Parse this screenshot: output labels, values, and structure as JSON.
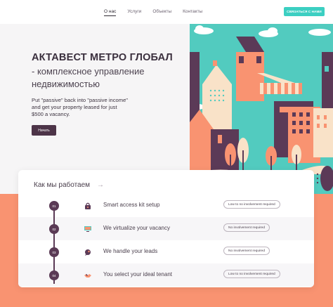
{
  "nav": {
    "links": [
      "О нас",
      "Услуги",
      "Объекты",
      "Контакты"
    ],
    "cta_label": "СВЯЗАТЬСЯ С НАМИ"
  },
  "hero": {
    "title": "АКТАВЕСТ МЕТРО ГЛОБАЛ",
    "subtitle": "- комплексное управление недвижимостью",
    "description": "Put \"passive\" back into \"passive income\" and get your property leased for just $500 a vacancy.",
    "button_label": "Начать"
  },
  "how": {
    "title": "Как мы работаем",
    "steps": [
      {
        "number": "01",
        "icon": "lock-icon",
        "label": "Smart access kit setup",
        "badge": "Low to no involvement required"
      },
      {
        "number": "02",
        "icon": "monitor-icon",
        "label": "We virtualize your vacancy",
        "badge": "No involvement required"
      },
      {
        "number": "03",
        "icon": "chat-bubble-icon",
        "label": "We handle your leads",
        "badge": "No involvement required"
      },
      {
        "number": "04",
        "icon": "handshake-icon",
        "label": "You select your ideal tenant",
        "badge": "Low to no involvement required"
      }
    ]
  },
  "colors": {
    "accent": "#3ccfc2",
    "primary": "#4d3448",
    "salmon": "#f99371",
    "teal_art": "#52cbbf"
  }
}
